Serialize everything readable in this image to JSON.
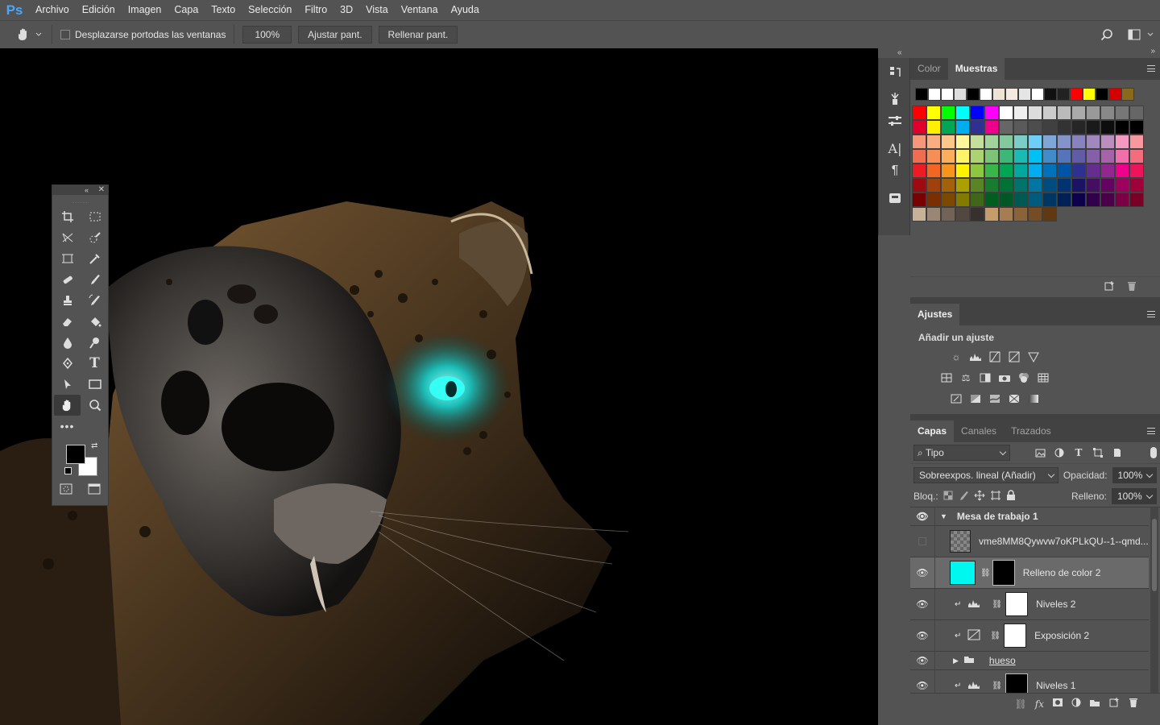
{
  "app": {
    "logo": "Ps"
  },
  "menu": [
    "Archivo",
    "Edición",
    "Imagen",
    "Capa",
    "Texto",
    "Selección",
    "Filtro",
    "3D",
    "Vista",
    "Ventana",
    "Ayuda"
  ],
  "options": {
    "scroll_all_label": "Desplazarse portodas las ventanas",
    "zoom": "100%",
    "fit_label": "Ajustar pant.",
    "fill_label": "Rellenar pant."
  },
  "swatches_panel": {
    "tabs": [
      "Color",
      "Muestras"
    ],
    "active": "Muestras"
  },
  "adjustments_panel": {
    "tab": "Ajustes",
    "heading": "Añadir un ajuste"
  },
  "layers_panel": {
    "tabs": [
      "Capas",
      "Canales",
      "Trazados"
    ],
    "filter_label": "Tipo",
    "blend_mode": "Sobreexpos. lineal (Añadir)",
    "opacity_label": "Opacidad:",
    "opacity": "100%",
    "lock_label": "Bloq.:",
    "fill_label": "Relleno:",
    "fill": "100%",
    "artboard": "Mesa de trabajo 1",
    "layers": [
      {
        "name": "vme8MM8Qywvw7oKPLkQU--1--qmd...",
        "visible": false
      },
      {
        "name": "Relleno de color 2",
        "visible": true,
        "selected": true
      },
      {
        "name": "Niveles 2",
        "visible": true
      },
      {
        "name": "Exposición 2",
        "visible": true
      },
      {
        "name": "hueso",
        "visible": true,
        "group": true
      },
      {
        "name": "Niveles 1",
        "visible": true
      }
    ]
  },
  "colors": {
    "accent_fill": "#00f7f0",
    "bg": "#535353",
    "canvas": "#000000"
  }
}
